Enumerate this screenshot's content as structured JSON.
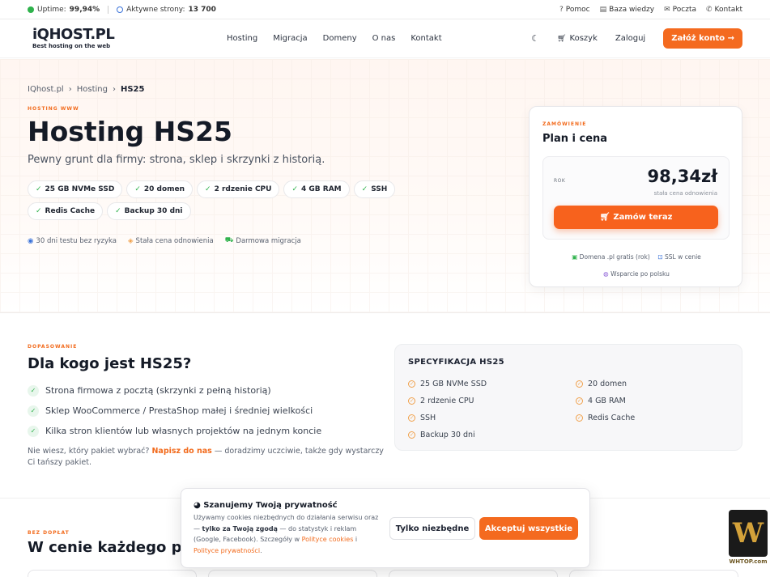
{
  "topbar": {
    "uptime_label": "Uptime:",
    "uptime_value": "99,94%",
    "sites_label": "Aktywne strony:",
    "sites_value": "13 700",
    "links": [
      "Pomoc",
      "Baza wiedzy",
      "Poczta",
      "Kontakt"
    ]
  },
  "nav": {
    "logo_main": "iQHOST.PL",
    "logo_tagline": "Best hosting on the web",
    "menu": [
      "Hosting",
      "Migracja",
      "Domeny",
      "O nas",
      "Kontakt"
    ],
    "cart": "Koszyk",
    "login": "Zaloguj",
    "signup": "Załóż konto"
  },
  "breadcrumb": {
    "home": "IQhost.pl",
    "section": "Hosting",
    "current": "HS25"
  },
  "hero": {
    "eyebrow": "HOSTING WWW",
    "title": "Hosting HS25",
    "lead": "Pewny grunt dla firmy: strona, sklep i skrzynki z historią.",
    "features": [
      "25 GB NVMe SSD",
      "20 domen",
      "2 rdzenie CPU",
      "4 GB RAM",
      "SSH",
      "Redis Cache",
      "Backup 30 dni"
    ],
    "perks": [
      "30 dni testu bez ryzyka",
      "Stała cena odnowienia",
      "Darmowa migracja"
    ]
  },
  "plan": {
    "eyebrow": "ZAMÓWIENIE",
    "title": "Plan i cena",
    "period": "ROK",
    "price": "98,34zł",
    "price_note": "stała cena odnowienia",
    "order": "Zamów teraz",
    "extra_domain": "Domena .pl gratis (rok)",
    "extra_ssl": "SSL w cenie",
    "extra_support": "Wsparcie po polsku"
  },
  "who": {
    "eyebrow": "DOPASOWANIE",
    "title": "Dla kogo jest HS25?",
    "uses": [
      "Strona firmowa z pocztą (skrzynki z pełną historią)",
      "Sklep WooCommerce / PrestaShop małej i średniej wielkości",
      "Kilka stron klientów lub własnych projektów na jednym koncie"
    ],
    "ask_prefix": "Nie wiesz, który pakiet wybrać?",
    "ask_link": "Napisz do nas",
    "ask_suffix": "— doradzimy uczciwie, także gdy wystarczy Ci tańszy pakiet."
  },
  "specs": {
    "title": "SPECYFIKACJA HS25",
    "items": [
      "25 GB NVMe SSD",
      "20 domen",
      "2 rdzenie CPU",
      "4 GB RAM",
      "SSH",
      "Redis Cache",
      "Backup 30 dni"
    ]
  },
  "pricing": {
    "eyebrow": "BEZ DOPŁAT",
    "title": "W cenie każdego pak"
  },
  "cookie": {
    "title": "Szanujemy Twoją prywatność",
    "text_1": "Używamy cookies niezbędnych do działania serwisu oraz —",
    "text_bold": "tylko za Twoją zgodą",
    "text_2": "— do statystyk i reklam (Google, Facebook). Szczegóły w",
    "link_1": "Polityce cookies",
    "text_3": "i",
    "link_2": "Polityce prywatności",
    "text_4": ".",
    "btn_necessary": "Tylko niezbędne",
    "btn_accept": "Akceptuj wszystkie"
  },
  "watermark": {
    "text": "WHTOP.com"
  },
  "colors": {
    "accent": "#f46a1f",
    "success": "#2fb24c",
    "text": "#141a26"
  }
}
